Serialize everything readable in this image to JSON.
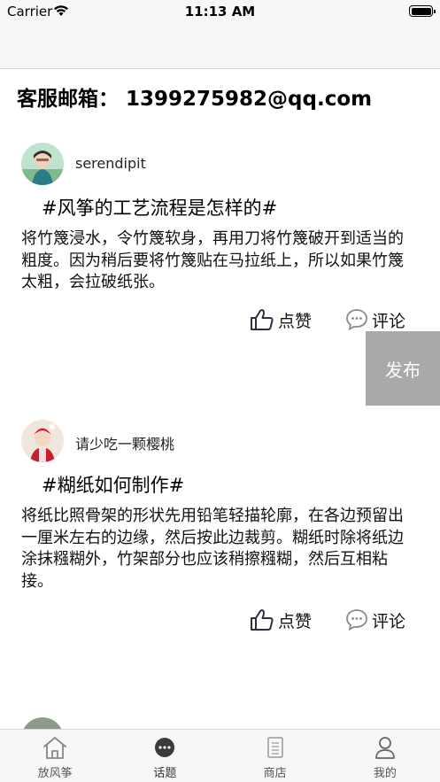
{
  "status_bar": {
    "carrier": "Carrier",
    "time": "11:13 AM",
    "battery_level": 1.0
  },
  "service": {
    "label": "客服邮箱：",
    "email": "1399275982@qq.com"
  },
  "posts": [
    {
      "username": "serendipit",
      "topic": "#风筝的工艺流程是怎样的#",
      "content": "将竹篾浸水，令竹篾软身，再用刀将竹篾破开到适当的粗度。因为稍后要将竹篾贴在马拉纸上，所以如果竹篾太粗，会拉破纸张。",
      "like_label": "点赞",
      "comment_label": "评论"
    },
    {
      "username": "请少吃一颗樱桃",
      "topic": "#糊纸如何制作#",
      "content": "将纸比照骨架的形状先用铅笔轻描轮廓，在各边预留出一厘米左右的边缘，然后按此边裁剪。糊纸时除将纸边涂抹糨糊外，竹架部分也应该稍擦糨糊，然后互相粘接。",
      "like_label": "点赞",
      "comment_label": "评论"
    }
  ],
  "publish_label": "发布",
  "tabs": [
    {
      "label": "放风筝",
      "icon": "home-icon"
    },
    {
      "label": "话题",
      "icon": "chat-icon"
    },
    {
      "label": "商店",
      "icon": "store-icon"
    },
    {
      "label": "我的",
      "icon": "profile-icon"
    }
  ],
  "active_tab": "话题"
}
